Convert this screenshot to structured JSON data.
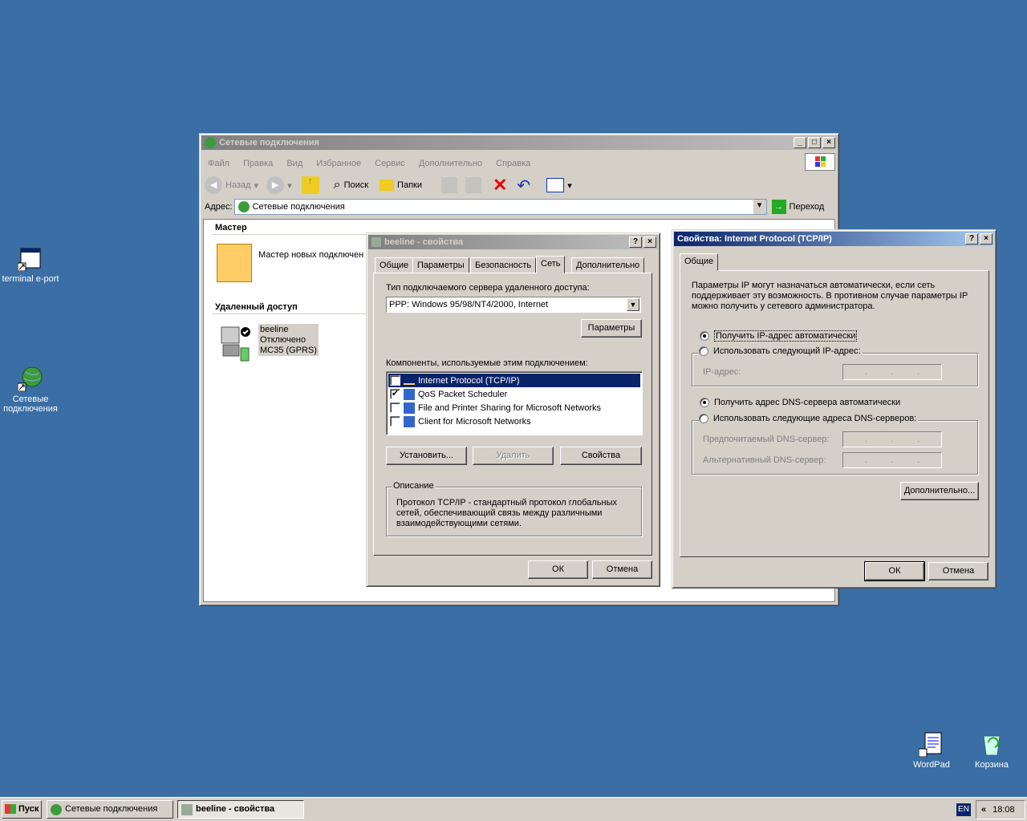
{
  "desktop": {
    "icons": [
      {
        "label": "terminal e-port"
      },
      {
        "label": "Сетевые подключения"
      },
      {
        "label": "WordPad"
      },
      {
        "label": "Корзина"
      }
    ]
  },
  "explorer": {
    "title": "Сетевые подключения",
    "menu": [
      "Файл",
      "Правка",
      "Вид",
      "Избранное",
      "Сервис",
      "Дополнительно",
      "Справка"
    ],
    "toolbar": {
      "back": "Назад",
      "search": "Поиск",
      "folders": "Папки"
    },
    "address_label": "Адрес:",
    "address_value": "Сетевые подключения",
    "go_label": "Переход",
    "section_wizard": "Мастер",
    "wizard_item": "Мастер новых подключен",
    "section_remote": "Удаленный доступ",
    "connection": {
      "name": "beeline",
      "status": "Отключено",
      "device": "MC35 (GPRS)"
    }
  },
  "beeline": {
    "title": "beeline - свойства",
    "tabs": [
      "Общие",
      "Параметры",
      "Безопасность",
      "Сеть",
      "Дополнительно"
    ],
    "server_type_label": "Тип подключаемого сервера удаленного доступа:",
    "server_type_value": "PPP: Windows 95/98/NT4/2000, Internet",
    "params_button": "Параметры",
    "components_label": "Компоненты, используемые этим подключением:",
    "components": [
      {
        "label": "Internet Protocol (TCP/IP)",
        "checked": true
      },
      {
        "label": "QoS Packet Scheduler",
        "checked": true
      },
      {
        "label": "File and Printer Sharing for Microsoft Networks",
        "checked": false
      },
      {
        "label": "Client for Microsoft Networks",
        "checked": false
      }
    ],
    "install_button": "Установить...",
    "remove_button": "Удалить",
    "props_button": "Свойства",
    "desc_label": "Описание",
    "desc_text": "Протокол TCP/IP - стандартный протокол глобальных сетей, обеспечивающий связь между различными взаимодействующими сетями.",
    "ok": "ОК",
    "cancel": "Отмена"
  },
  "tcpip": {
    "title": "Свойства: Internet Protocol (TCP/IP)",
    "tab": "Общие",
    "intro": "Параметры IP могут назначаться автоматически, если сеть поддерживает эту возможность. В противном случае параметры IP можно получить у сетевого администратора.",
    "ip_auto": "Получить IP-адрес автоматически",
    "ip_manual": "Использовать следующий IP-адрес:",
    "ip_label": "IP-адрес:",
    "dns_auto": "Получить адрес DNS-сервера автоматически",
    "dns_manual": "Использовать следующие адреса DNS-серверов:",
    "dns_pref": "Предпочитаемый DNS-сервер:",
    "dns_alt": "Альтернативный DNS-сервер:",
    "advanced": "Дополнительно...",
    "ok": "ОК",
    "cancel": "Отмена"
  },
  "taskbar": {
    "start": "Пуск",
    "tasks": [
      "Сетевые подключения",
      "beeline - свойства"
    ],
    "lang": "EN",
    "clock": "18:08"
  }
}
